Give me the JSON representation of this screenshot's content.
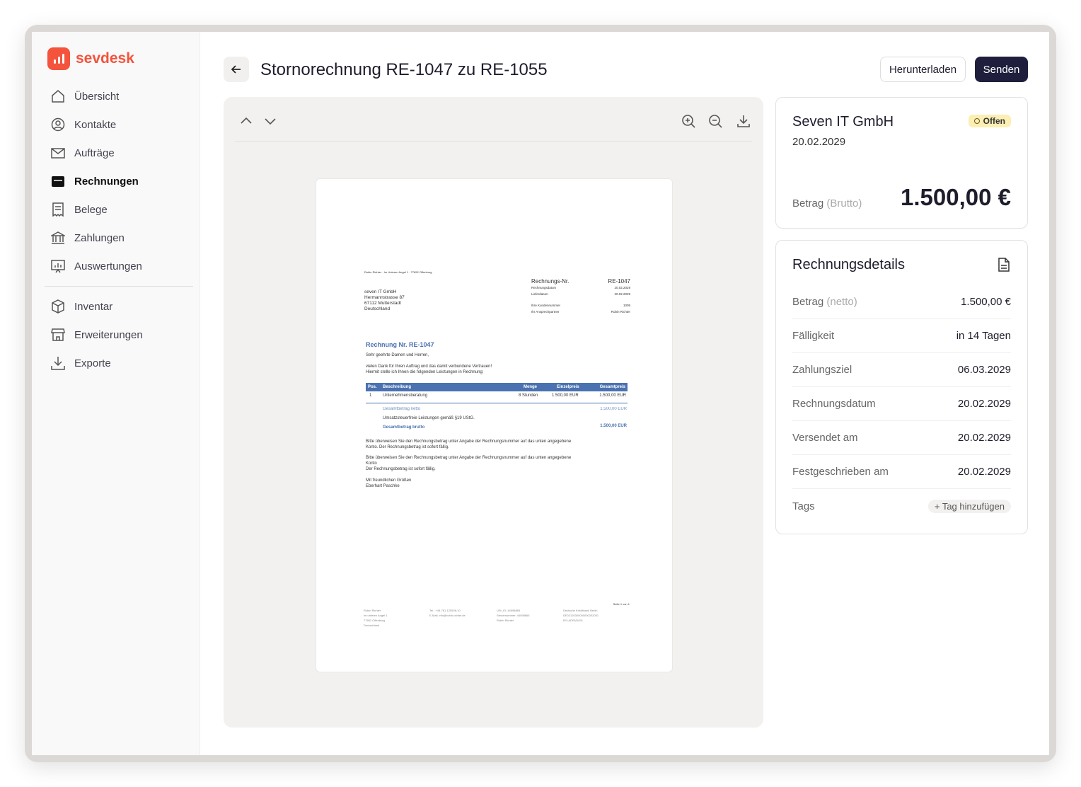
{
  "brand": {
    "name": "sevdesk",
    "color": "#f4533c"
  },
  "sidebar": {
    "items": [
      {
        "label": "Übersicht",
        "icon": "home-icon"
      },
      {
        "label": "Kontakte",
        "icon": "user-circle-icon"
      },
      {
        "label": "Aufträge",
        "icon": "mail-icon"
      },
      {
        "label": "Rechnungen",
        "icon": "inbox-icon",
        "active": true
      },
      {
        "label": "Belege",
        "icon": "receipt-icon"
      },
      {
        "label": "Zahlungen",
        "icon": "bank-icon"
      },
      {
        "label": "Auswertungen",
        "icon": "chart-icon"
      }
    ],
    "items2": [
      {
        "label": "Inventar",
        "icon": "box-icon"
      },
      {
        "label": "Erweiterungen",
        "icon": "store-icon"
      },
      {
        "label": "Exporte",
        "icon": "download-icon"
      }
    ]
  },
  "header": {
    "title": "Stornorechnung RE-1047 zu RE-1055",
    "download_label": "Herunterladen",
    "send_label": "Senden"
  },
  "document": {
    "sender_line": "Robin Richter · Im Unteren Angel 1 · 77652 Offenburg",
    "recipient": [
      "seven IT GmbH",
      "Hermannstrasse 87",
      "67112 Mutterstadt",
      "Deutschland"
    ],
    "meta": {
      "nr_label": "Rechnungs-Nr.",
      "nr": "RE-1047",
      "date_label": "Rechnungsdatum",
      "date": "20.02.2029",
      "delivery_label": "Lieferdatum",
      "delivery": "20.02.2029",
      "customer_label": "Ihre Kundennummer",
      "customer": "1005",
      "contact_label": "Ihr Ansprechpartner",
      "contact": "Robin Richter"
    },
    "heading": "Rechnung Nr. RE-1047",
    "greeting": "Sehr geehrte Damen und Herren,",
    "intro1": "vielen Dank für Ihren Auftrag und das damit verbundene Vertrauen!",
    "intro2": "Hiermit stelle ich Ihnen die folgenden Leistungen in Rechnung:",
    "table": {
      "headers": [
        "Pos.",
        "Beschreibung",
        "Menge",
        "Einzelpreis",
        "Gesamtpreis"
      ],
      "rows": [
        [
          "1",
          "Unternehmensberatung",
          "8 Stunden",
          "1.500,00 EUR",
          "1.500,00 EUR"
        ]
      ]
    },
    "net_label": "Gesamtbetrag netto",
    "net": "1.500,00 EUR",
    "tax_note": "Umsatzsteuerfreie Leistungen gemäß §19 UStG.",
    "gross_label": "Gesamtbetrag brutto",
    "gross": "1.500,00 EUR",
    "pay1a": "Bitte überweisen Sie den Rechnungsbetrag unter Angabe der Rechnungsnummer auf das unten angegebene",
    "pay1b": "Konto. Der Rechnungsbetrag ist sofort fällig.",
    "pay2a": "Bitte überweisen Sie den Rechnungsbetrag unter Angabe der Rechnungsnummer auf das unten angegebene",
    "pay2b": "Konto",
    "pay2c": "Der Rechnungsbetrag ist sofort fällig.",
    "closing": "Mit freundlichen Grüßen",
    "signer": "Eberhart Paschke",
    "page_no": "Seite 1 von 1",
    "footer": [
      [
        "Robin Richter",
        "Im unteren Angel 1",
        "77652 Offenburg",
        "Deutschland"
      ],
      [
        "Tel.: +49-781-125508-10",
        "E-Mail: info@robin-richter.de"
      ],
      [
        "USt.-ID: 44598865",
        "Steuernummer: 44598865",
        "Robin Richter"
      ],
      [
        "Deutsche Kreditbank Berlin",
        "DE02120300000000202051",
        "BYLADEM1001"
      ]
    ]
  },
  "summary": {
    "company": "Seven IT GmbH",
    "date": "20.02.2029",
    "status": "Offen",
    "amount_label": "Betrag",
    "amount_sub": "(Brutto)",
    "amount": "1.500,00 €"
  },
  "details": {
    "title": "Rechnungsdetails",
    "rows": [
      {
        "label": "Betrag",
        "sub": "(netto)",
        "value": "1.500,00 €"
      },
      {
        "label": "Fälligkeit",
        "value": "in 14 Tagen"
      },
      {
        "label": "Zahlungsziel",
        "value": "06.03.2029"
      },
      {
        "label": "Rechnungsdatum",
        "value": "20.02.2029"
      },
      {
        "label": "Versendet am",
        "value": "20.02.2029"
      },
      {
        "label": "Festgeschrieben am",
        "value": "20.02.2029"
      }
    ],
    "tags_label": "Tags",
    "add_tag": "Tag hinzufügen"
  }
}
